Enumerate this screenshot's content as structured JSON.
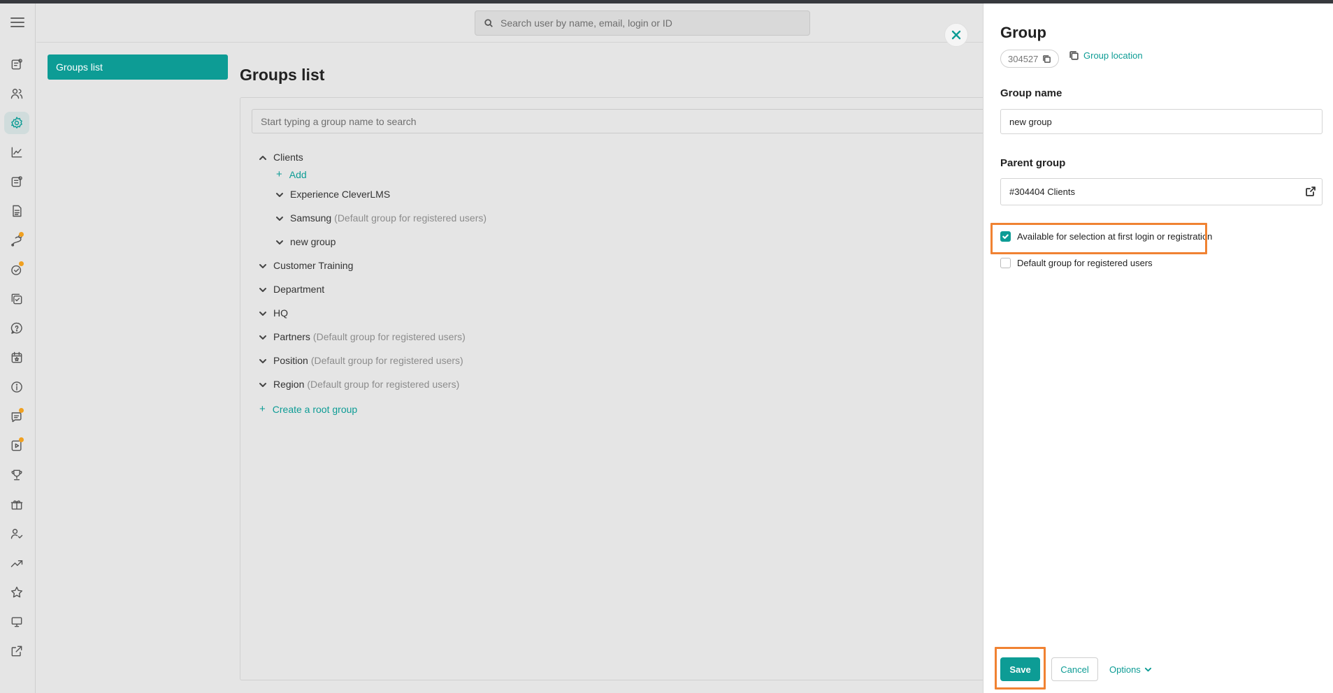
{
  "header": {
    "search_placeholder": "Search user by name, email, login or ID"
  },
  "sidebar": {
    "items": [
      {
        "icon": "course-icon"
      },
      {
        "icon": "users-icon"
      },
      {
        "icon": "settings-icon",
        "active": true
      },
      {
        "icon": "analytics-icon"
      },
      {
        "icon": "assignments-icon"
      },
      {
        "icon": "documents-icon"
      },
      {
        "icon": "learning-path-icon"
      },
      {
        "icon": "tasks-icon",
        "badge": true
      },
      {
        "icon": "checklist-icon"
      },
      {
        "icon": "questions-icon"
      },
      {
        "icon": "calendar-icon"
      },
      {
        "icon": "info-icon"
      },
      {
        "icon": "chat-icon",
        "badge": true
      },
      {
        "icon": "video-icon",
        "badge": true
      },
      {
        "icon": "trophy-icon"
      },
      {
        "icon": "gift-icon"
      },
      {
        "icon": "user-check-icon"
      },
      {
        "icon": "trending-icon"
      },
      {
        "icon": "star-icon"
      },
      {
        "icon": "monitor-icon"
      },
      {
        "icon": "external-link-icon"
      }
    ]
  },
  "left_nav": {
    "groups_list_label": "Groups list"
  },
  "main": {
    "title": "Groups list",
    "search_placeholder": "Start typing a group name to search",
    "tree": {
      "clients": "Clients",
      "add": "Add",
      "experience": "Experience CleverLMS",
      "samsung": "Samsung",
      "samsung_note": "(Default group for registered users)",
      "new_group": "new group",
      "customer_training": "Customer Training",
      "department": "Department",
      "hq": "HQ",
      "partners": "Partners",
      "partners_note": "(Default group for registered users)",
      "position": "Position",
      "position_note": "(Default group for registered users)",
      "region": "Region",
      "region_note": "(Default group for registered users)",
      "create_root": "Create a root group"
    }
  },
  "panel": {
    "title": "Group",
    "group_id": "304527",
    "location_link": "Group location",
    "name_label": "Group name",
    "name_value": "new group",
    "parent_label": "Parent group",
    "parent_value": "#304404 Clients",
    "available_label": "Available for selection at first login or registration",
    "available_checked": true,
    "default_label": "Default group for registered users",
    "default_checked": false,
    "save": "Save",
    "cancel": "Cancel",
    "options": "Options"
  },
  "colors": {
    "accent": "#0d9c95",
    "highlight": "#f08232"
  }
}
